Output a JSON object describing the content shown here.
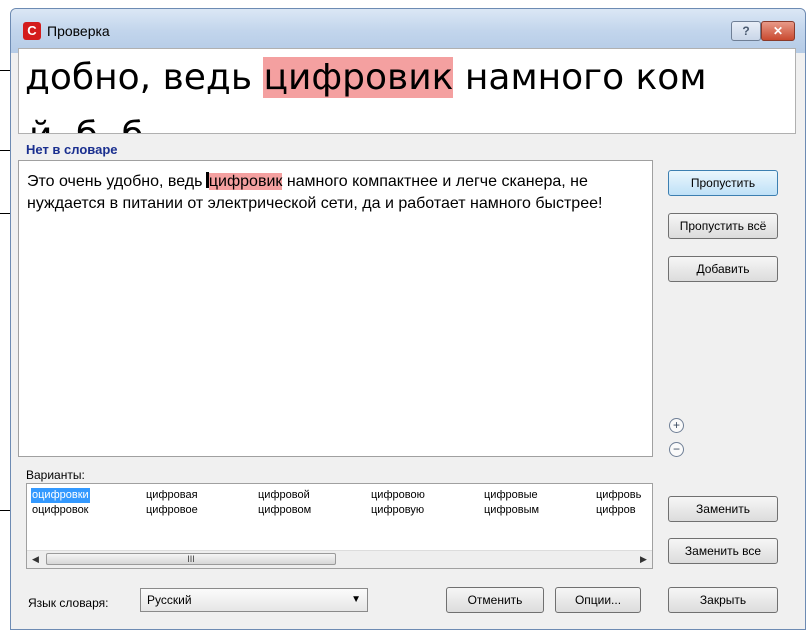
{
  "window": {
    "title": "Проверка",
    "help_label": "?",
    "close_label": "✕"
  },
  "preview": {
    "before": "добно, ведь ",
    "word": "цифровик",
    "after": " намного ком",
    "next_line_fragment": "      й               б                       б"
  },
  "status": {
    "not_in_dictionary": "Нет в словаре"
  },
  "editor": {
    "before": "Это очень удобно, ведь ",
    "word": "цифровик",
    "after": " намного компактнее и легче сканера, не нуждается в питании от электрической сети, да и работает намного быстрее!"
  },
  "buttons": {
    "skip": "Пропустить",
    "skip_all": "Пропустить всё",
    "add": "Добавить",
    "replace": "Заменить",
    "replace_all": "Заменить все",
    "close": "Закрыть",
    "cancel": "Отменить",
    "options": "Опции..."
  },
  "zoom": {
    "in_icon": "zoom-in-icon",
    "out_icon": "zoom-out-icon"
  },
  "variants": {
    "label": "Варианты:",
    "columns": [
      [
        "оцифровки",
        "оцифровок"
      ],
      [
        "цифровая",
        "цифровое"
      ],
      [
        "цифровой",
        "цифровом"
      ],
      [
        "цифровою",
        "цифровую"
      ],
      [
        "цифровые",
        "цифровым"
      ],
      [
        "цифровь",
        "цифров"
      ]
    ],
    "selected": "оцифровки",
    "scroll_thumb_grip": "III"
  },
  "language": {
    "label": "Язык словаря:",
    "value": "Русский"
  },
  "colors": {
    "highlight": "#f4a0a0",
    "status_text": "#1a2f8f",
    "selection": "#3399ff"
  }
}
